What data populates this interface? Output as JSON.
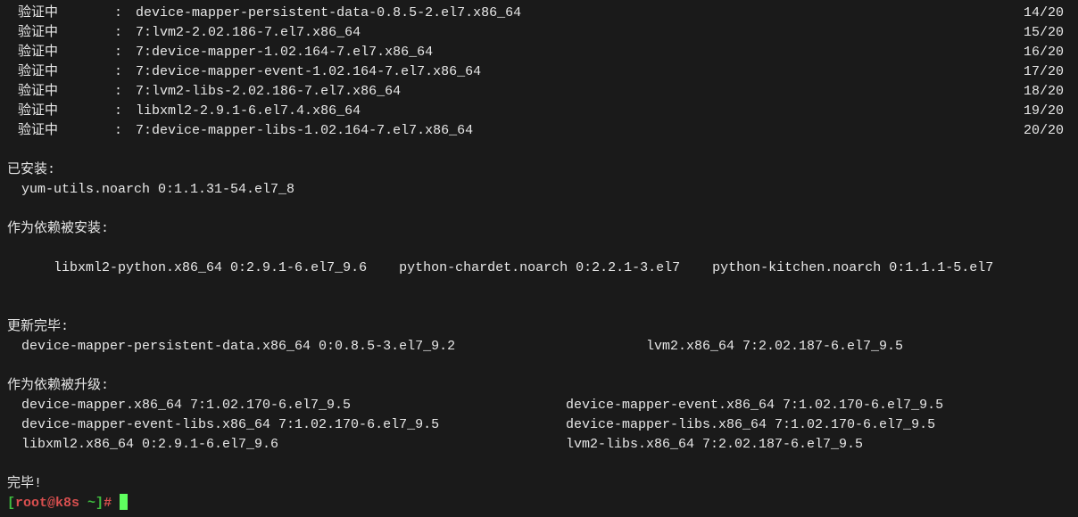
{
  "verify": {
    "label": "验证中",
    "colon": ": ",
    "rows": [
      {
        "pkg": "device-mapper-persistent-data-0.8.5-2.el7.x86_64",
        "count": "14/20"
      },
      {
        "pkg": "7:lvm2-2.02.186-7.el7.x86_64",
        "count": "15/20"
      },
      {
        "pkg": "7:device-mapper-1.02.164-7.el7.x86_64",
        "count": "16/20"
      },
      {
        "pkg": "7:device-mapper-event-1.02.164-7.el7.x86_64",
        "count": "17/20"
      },
      {
        "pkg": "7:lvm2-libs-2.02.186-7.el7.x86_64",
        "count": "18/20"
      },
      {
        "pkg": "libxml2-2.9.1-6.el7.4.x86_64",
        "count": "19/20"
      },
      {
        "pkg": "7:device-mapper-libs-1.02.164-7.el7.x86_64",
        "count": "20/20"
      }
    ]
  },
  "installed": {
    "header": "已安装:",
    "pkg": "yum-utils.noarch 0:1.1.31-54.el7_8"
  },
  "depInstalled": {
    "header": "作为依赖被安装:",
    "pkgs": [
      "libxml2-python.x86_64 0:2.9.1-6.el7_9.6",
      "python-chardet.noarch 0:2.2.1-3.el7",
      "python-kitchen.noarch 0:1.1.1-5.el7"
    ]
  },
  "updated": {
    "header": "更新完毕:",
    "rows": [
      {
        "left": "device-mapper-persistent-data.x86_64 0:0.8.5-3.el7_9.2",
        "right": "lvm2.x86_64 7:2.02.187-6.el7_9.5"
      }
    ]
  },
  "depUpgraded": {
    "header": "作为依赖被升级:",
    "rows": [
      {
        "left": "device-mapper.x86_64 7:1.02.170-6.el7_9.5",
        "right": "device-mapper-event.x86_64 7:1.02.170-6.el7_9.5"
      },
      {
        "left": "device-mapper-event-libs.x86_64 7:1.02.170-6.el7_9.5",
        "right": "device-mapper-libs.x86_64 7:1.02.170-6.el7_9.5"
      },
      {
        "left": "libxml2.x86_64 0:2.9.1-6.el7_9.6",
        "right": "lvm2-libs.x86_64 7:2.02.187-6.el7_9.5"
      }
    ]
  },
  "done": "完毕!",
  "prompt": {
    "bracketOpen": "[",
    "userHost": "root@k8s ",
    "tilde": "~",
    "bracketClose": "]",
    "hash": "# "
  }
}
